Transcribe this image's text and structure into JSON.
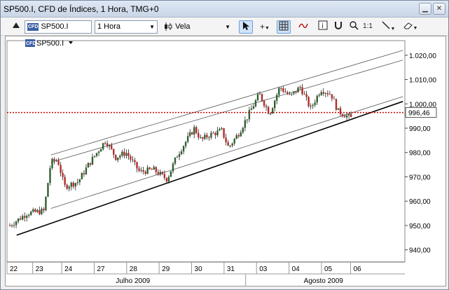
{
  "window": {
    "title": "SP500.I, CFD de Índices, 1 Hora, TMG+0",
    "minimize_glyph": "▁",
    "close_glyph": "✕"
  },
  "toolbar": {
    "symbol": "SP500.I",
    "symbol_badge": "CFD",
    "timeframe": "1 Hora",
    "chart_style": "Vela",
    "tools": [
      "cursor-icon",
      "crosshair-icon",
      "grid-icon",
      "indicators-icon",
      "info-icon",
      "one-to-one-icon",
      "zoom-icon",
      "trendline-icon",
      "eraser-icon"
    ],
    "one_to_one_label": "1:1"
  },
  "chart": {
    "symbol_label": "SP500.I",
    "price_label": "996,46",
    "x_labels": [
      "22",
      "23",
      "24",
      "27",
      "28",
      "29",
      "30",
      "31",
      "03",
      "04",
      "05",
      "06"
    ],
    "months": [
      "Julho 2009",
      "Agosto 2009"
    ],
    "y_tick_labels": [
      "1.020,00",
      "1.010,00",
      "1.000,00",
      "990,00",
      "980,00",
      "970,00",
      "960,00",
      "950,00",
      "940,00"
    ],
    "colors": {
      "up": "#2f5f2f",
      "down": "#b52a2a",
      "price_line": "#cc0000"
    }
  },
  "chart_data": {
    "type": "candlestick",
    "ylim": [
      935,
      1026
    ],
    "y_ticks": [
      1020,
      1010,
      1000,
      990,
      980,
      970,
      960,
      950,
      940
    ],
    "x_days": [
      "22",
      "23",
      "24",
      "27",
      "28",
      "29",
      "30",
      "31",
      "03",
      "04",
      "05",
      "06"
    ],
    "last_price": 996.46,
    "close_path": [
      {
        "t": 0,
        "v": 950
      },
      {
        "t": 5,
        "v": 955
      },
      {
        "t": 10,
        "v": 956
      },
      {
        "t": 12,
        "v": 976
      },
      {
        "t": 14,
        "v": 977
      },
      {
        "t": 16,
        "v": 966
      },
      {
        "t": 20,
        "v": 968
      },
      {
        "t": 23,
        "v": 975
      },
      {
        "t": 28,
        "v": 985
      },
      {
        "t": 31,
        "v": 978
      },
      {
        "t": 34,
        "v": 980
      },
      {
        "t": 38,
        "v": 972
      },
      {
        "t": 42,
        "v": 973
      },
      {
        "t": 46,
        "v": 969
      },
      {
        "t": 49,
        "v": 979
      },
      {
        "t": 54,
        "v": 990
      },
      {
        "t": 56,
        "v": 985
      },
      {
        "t": 58,
        "v": 987
      },
      {
        "t": 62,
        "v": 989
      },
      {
        "t": 64,
        "v": 982
      },
      {
        "t": 67,
        "v": 988
      },
      {
        "t": 70,
        "v": 996
      },
      {
        "t": 73,
        "v": 1004
      },
      {
        "t": 76,
        "v": 996
      },
      {
        "t": 79,
        "v": 1007
      },
      {
        "t": 82,
        "v": 1003
      },
      {
        "t": 85,
        "v": 1007
      },
      {
        "t": 88,
        "v": 998
      },
      {
        "t": 91,
        "v": 1006
      },
      {
        "t": 94,
        "v": 1004
      },
      {
        "t": 96,
        "v": 997
      },
      {
        "t": 100,
        "v": 994
      }
    ]
  }
}
